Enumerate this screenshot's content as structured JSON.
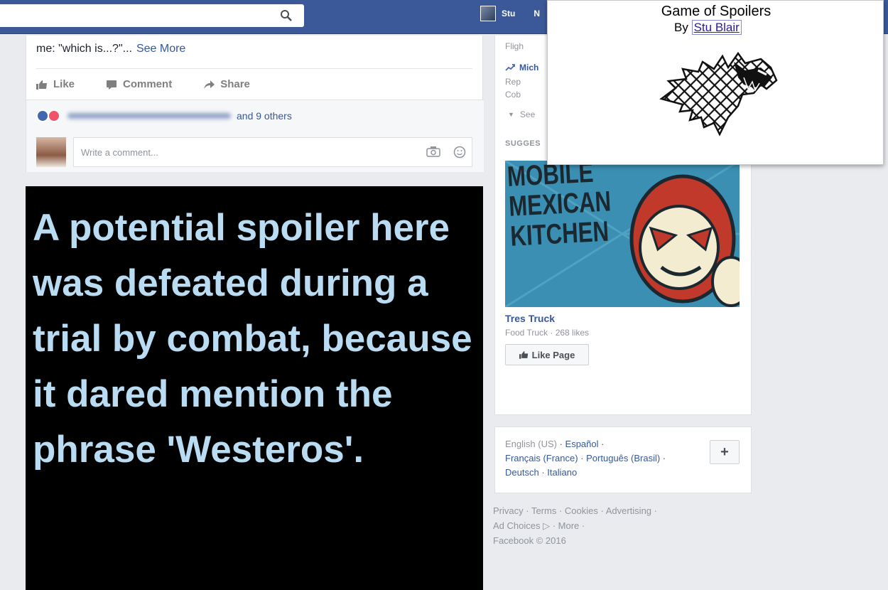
{
  "topbar": {
    "user_name": "Stu",
    "next_label_fragment": "N"
  },
  "post": {
    "snippet_prefix": "me: \"which is...?\"...",
    "see_more": "See More",
    "actions": {
      "like": "Like",
      "comment": "Comment",
      "share": "Share"
    },
    "reactions_suffix": "and 9 others",
    "comment_placeholder": "Write a comment..."
  },
  "spoiler": {
    "text": "A potential spoiler here was defeated during a trial by combat, because it dared mention the phrase 'Westeros'."
  },
  "sidebar": {
    "trending_fragments": [
      "Fligh",
      "Mich",
      "Rep",
      "Cob",
      "See"
    ],
    "suggested_label": "SUGGES",
    "ad_image_text": [
      "MOBILE",
      "MEXICAN",
      "KITCHEN"
    ],
    "ad_title": "Tres Truck",
    "ad_subtitle": "Food Truck · 268 likes",
    "like_page": "Like Page"
  },
  "languages": {
    "current": "English (US)",
    "others": [
      "Español",
      "Français (France)",
      "Português (Brasil)",
      "Deutsch",
      "Italiano"
    ],
    "plus": "+"
  },
  "footer": {
    "links": [
      "Privacy",
      "Terms",
      "Cookies",
      "Advertising",
      "Ad Choices",
      "More"
    ],
    "copyright": "Facebook © 2016"
  },
  "popup": {
    "title": "Game of Spoilers",
    "by": "By",
    "author": "Stu Blair"
  },
  "colors": {
    "facebook_blue": "#3b5998",
    "spoiler_text": "#b9dcf3",
    "spoiler_background": "#000000",
    "link": "#365899"
  }
}
